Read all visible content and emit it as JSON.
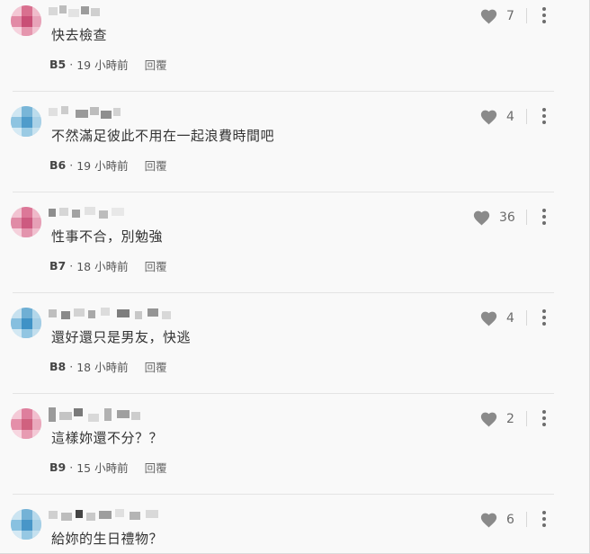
{
  "comments": [
    {
      "text": "快去檢查",
      "floor": "B5",
      "time": "19 小時前",
      "reply": "回覆",
      "likes": "7",
      "avatar": "pink"
    },
    {
      "text": "不然滿足彼此不用在一起浪費時間吧",
      "floor": "B6",
      "time": "19 小時前",
      "reply": "回覆",
      "likes": "4",
      "avatar": "blue"
    },
    {
      "text": "性事不合，別勉強",
      "floor": "B7",
      "time": "18 小時前",
      "reply": "回覆",
      "likes": "36",
      "avatar": "pink"
    },
    {
      "text": "還好還只是男友，快逃",
      "floor": "B8",
      "time": "18 小時前",
      "reply": "回覆",
      "likes": "4",
      "avatar": "blue"
    },
    {
      "text": "這樣妳還不分？？",
      "floor": "B9",
      "time": "15 小時前",
      "reply": "回覆",
      "likes": "2",
      "avatar": "pink"
    },
    {
      "text": "給妳的生日禮物？",
      "floor": "",
      "time": "",
      "reply": "",
      "likes": "6",
      "avatar": "blue"
    }
  ],
  "separator": "·",
  "icons": {
    "like": "heart-icon",
    "more": "more-vertical-icon"
  },
  "colors": {
    "heart": "#8a8a8a",
    "background": "#f9f9f9",
    "divider": "#e4e4e4"
  }
}
